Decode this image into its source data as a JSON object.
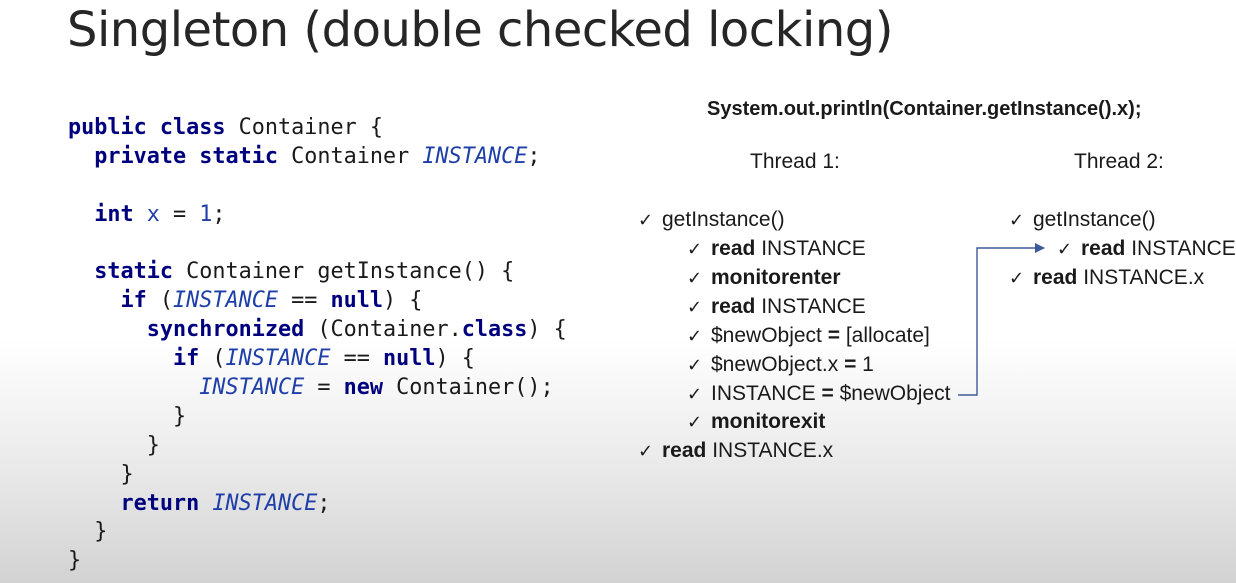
{
  "title": "Singleton (double checked locking)",
  "code_lines": [
    [
      {
        "t": "public ",
        "c": "kw"
      },
      {
        "t": "class ",
        "c": "kw"
      },
      {
        "t": "Container {",
        "c": ""
      }
    ],
    [
      {
        "t": "  ",
        "c": ""
      },
      {
        "t": "private ",
        "c": "kw"
      },
      {
        "t": "static ",
        "c": "kw"
      },
      {
        "t": "Container ",
        "c": ""
      },
      {
        "t": "INSTANCE",
        "c": "fld"
      },
      {
        "t": ";",
        "c": ""
      }
    ],
    [],
    [
      {
        "t": "  ",
        "c": ""
      },
      {
        "t": "int ",
        "c": "kw"
      },
      {
        "t": "x",
        "c": "num"
      },
      {
        "t": " = ",
        "c": ""
      },
      {
        "t": "1",
        "c": "num"
      },
      {
        "t": ";",
        "c": ""
      }
    ],
    [],
    [
      {
        "t": "  ",
        "c": ""
      },
      {
        "t": "static ",
        "c": "kw"
      },
      {
        "t": "Container getInstance() {",
        "c": ""
      }
    ],
    [
      {
        "t": "    ",
        "c": ""
      },
      {
        "t": "if",
        "c": "kw"
      },
      {
        "t": " (",
        "c": ""
      },
      {
        "t": "INSTANCE",
        "c": "fld"
      },
      {
        "t": " == ",
        "c": ""
      },
      {
        "t": "null",
        "c": "kw"
      },
      {
        "t": ") {",
        "c": ""
      }
    ],
    [
      {
        "t": "      ",
        "c": ""
      },
      {
        "t": "synchronized",
        "c": "kw"
      },
      {
        "t": " (Container.",
        "c": ""
      },
      {
        "t": "class",
        "c": "kw"
      },
      {
        "t": ") {",
        "c": ""
      }
    ],
    [
      {
        "t": "        ",
        "c": ""
      },
      {
        "t": "if",
        "c": "kw"
      },
      {
        "t": " (",
        "c": ""
      },
      {
        "t": "INSTANCE",
        "c": "fld"
      },
      {
        "t": " == ",
        "c": ""
      },
      {
        "t": "null",
        "c": "kw"
      },
      {
        "t": ") {",
        "c": ""
      }
    ],
    [
      {
        "t": "          ",
        "c": ""
      },
      {
        "t": "INSTANCE",
        "c": "fld"
      },
      {
        "t": " = ",
        "c": ""
      },
      {
        "t": "new",
        "c": "kw"
      },
      {
        "t": " Container();",
        "c": ""
      }
    ],
    [
      {
        "t": "        }",
        "c": ""
      }
    ],
    [
      {
        "t": "      }",
        "c": ""
      }
    ],
    [
      {
        "t": "    }",
        "c": ""
      }
    ],
    [
      {
        "t": "    ",
        "c": ""
      },
      {
        "t": "return ",
        "c": "kw"
      },
      {
        "t": "INSTANCE",
        "c": "fld"
      },
      {
        "t": ";",
        "c": ""
      }
    ],
    [
      {
        "t": "  }",
        "c": ""
      }
    ],
    [
      {
        "t": "}",
        "c": ""
      }
    ]
  ],
  "statement": "System.out.println(Container.getInstance().x);",
  "thread1": {
    "header": "Thread 1:",
    "steps": [
      {
        "parts": [
          {
            "t": "getInstance()",
            "b": false
          }
        ]
      },
      {
        "parts": [
          {
            "t": "read",
            "b": true
          },
          {
            "t": " INSTANCE",
            "b": false
          }
        ]
      },
      {
        "parts": [
          {
            "t": "monitorenter",
            "b": true
          }
        ]
      },
      {
        "parts": [
          {
            "t": "read",
            "b": true
          },
          {
            "t": " INSTANCE",
            "b": false
          }
        ]
      },
      {
        "parts": [
          {
            "t": "$newObject ",
            "b": false
          },
          {
            "t": "=",
            "b": true
          },
          {
            "t": " [allocate]",
            "b": false
          }
        ]
      },
      {
        "parts": [
          {
            "t": "$newObject.x ",
            "b": false
          },
          {
            "t": "=",
            "b": true
          },
          {
            "t": " 1",
            "b": false
          }
        ]
      },
      {
        "parts": [
          {
            "t": "INSTANCE ",
            "b": false
          },
          {
            "t": "=",
            "b": true
          },
          {
            "t": " $newObject",
            "b": false
          }
        ]
      },
      {
        "parts": [
          {
            "t": "monitorexit",
            "b": true
          }
        ]
      },
      {
        "parts": [
          {
            "t": "read",
            "b": true
          },
          {
            "t": " INSTANCE.x",
            "b": false
          }
        ]
      }
    ]
  },
  "thread2": {
    "header": "Thread 2:",
    "steps": [
      {
        "parts": [
          {
            "t": "getInstance()",
            "b": false
          }
        ]
      },
      {
        "parts": [
          {
            "t": "read",
            "b": true
          },
          {
            "t": " INSTANCE",
            "b": false
          }
        ]
      },
      {
        "parts": [
          {
            "t": "read",
            "b": true
          },
          {
            "t": " INSTANCE.x",
            "b": false
          }
        ]
      }
    ]
  },
  "check_glyph": "✓",
  "colors": {
    "keyword": "#00007f",
    "field": "#1f3fa8",
    "arrow": "#3d5a9a"
  }
}
